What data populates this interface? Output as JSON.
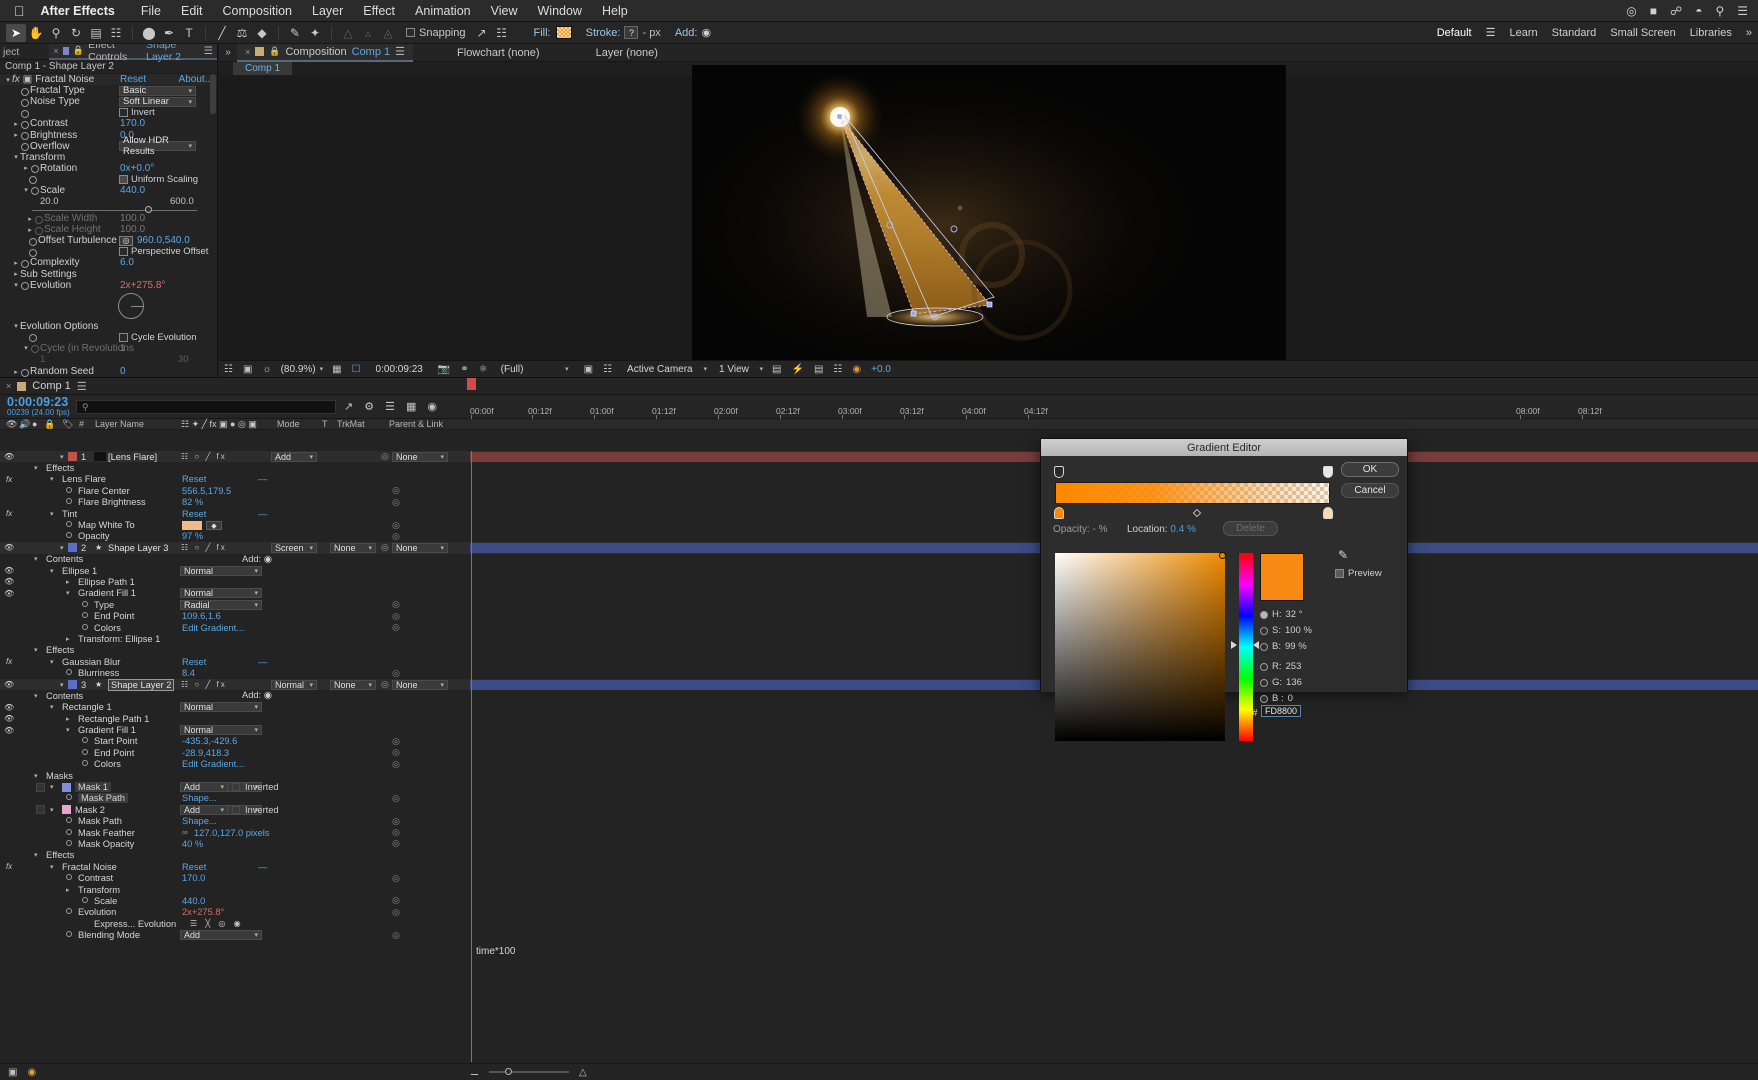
{
  "menubar": {
    "apple": "apple-logo",
    "app": "After Effects",
    "items": [
      "File",
      "Edit",
      "Composition",
      "Layer",
      "Effect",
      "Animation",
      "View",
      "Window",
      "Help"
    ],
    "status_icons": [
      "screen-record-icon",
      "battery-icon",
      "bluetooth-icon",
      "wifi-icon",
      "search-icon",
      "control-center-icon"
    ]
  },
  "toolbar": {
    "tools": [
      "selection-tool",
      "hand-tool",
      "zoom-tool",
      "rotation-tool",
      "camera-tool",
      "pan-behind-tool",
      "shape-tool",
      "pen-tool",
      "type-tool",
      "brush-tool",
      "clone-stamp-tool",
      "eraser-tool",
      "roto-brush-tool",
      "puppet-pin-tool"
    ],
    "dim_tools": [
      "puppet-starch-tool",
      "puppet-overlap-tool",
      "puppet-advanced-tool"
    ],
    "snapping_label": "Snapping",
    "snapping_checked": false,
    "fill_label": "Fill:",
    "stroke_label": "Stroke:",
    "stroke_value": "?",
    "stroke_unit": "- px",
    "add_label": "Add:",
    "fill_color": "#f49c2e",
    "workspaces": [
      "Default",
      "Learn",
      "Standard",
      "Small Screen",
      "Libraries"
    ],
    "workspace_active": "Default"
  },
  "effect_controls": {
    "project_tab": "ject",
    "tab_prefix": "Effect Controls",
    "tab_layer": "Shape Layer 2",
    "subtitle": "Comp 1 - Shape Layer 2",
    "effect_name": "Fractal Noise",
    "reset": "Reset",
    "about": "About...",
    "rows": [
      {
        "label": "Fractal Type",
        "value": "Basic",
        "kind": "select"
      },
      {
        "label": "Noise Type",
        "value": "Soft Linear",
        "kind": "select"
      },
      {
        "label": "Invert",
        "value": "",
        "kind": "checkbox",
        "checked": false
      },
      {
        "label": "Contrast",
        "value": "170.0",
        "kind": "num"
      },
      {
        "label": "Brightness",
        "value": "0.0",
        "kind": "num"
      },
      {
        "label": "Overflow",
        "value": "Allow HDR Results",
        "kind": "select"
      },
      {
        "label": "Transform",
        "value": "",
        "kind": "group"
      },
      {
        "label": "Rotation",
        "value": "0x+0.0°",
        "kind": "num"
      },
      {
        "label": "Uniform Scaling",
        "value": "",
        "kind": "checkbox",
        "checked": true
      },
      {
        "label": "Scale",
        "value": "440.0",
        "kind": "num"
      },
      {
        "label": "Scale Width",
        "value": "100.0",
        "kind": "num-dim"
      },
      {
        "label": "Scale Height",
        "value": "100.0",
        "kind": "num-dim"
      },
      {
        "label": "Offset Turbulence",
        "value": "960.0,540.0",
        "kind": "point"
      },
      {
        "label": "Perspective Offset",
        "value": "",
        "kind": "checkbox",
        "checked": false
      },
      {
        "label": "Complexity",
        "value": "6.0",
        "kind": "num"
      },
      {
        "label": "Sub Settings",
        "value": "",
        "kind": "group"
      },
      {
        "label": "Evolution",
        "value": "2x+275.8°",
        "kind": "angle"
      },
      {
        "label": "Evolution Options",
        "value": "",
        "kind": "group"
      },
      {
        "label": "Cycle Evolution",
        "value": "",
        "kind": "checkbox",
        "checked": false
      },
      {
        "label": "Cycle (in Revolutions",
        "value": "1",
        "kind": "num-dim"
      },
      {
        "label": "Random Seed",
        "value": "0",
        "kind": "num"
      }
    ],
    "slider": {
      "min": "20.0",
      "max": "600.0"
    },
    "cycle_max": "30"
  },
  "comp_panel": {
    "expand": "»",
    "tab_prefix": "Composition",
    "tab_name": "Comp 1",
    "flowchart": "Flowchart (none)",
    "layer": "Layer (none)",
    "comp_tag": "Comp 1",
    "viewer_toolbar": {
      "magnification": "(80.9%)",
      "timecode": "0:00:09:23",
      "resolution": "(Full)",
      "camera": "Active Camera",
      "views": "1 View",
      "exposure": "+0.0"
    }
  },
  "timeline": {
    "tab_name": "Comp 1",
    "current_time": "0:00:09:23",
    "frame_info": "00239 (24.00 fps)",
    "search_placeholder": "",
    "ruler_ticks": [
      "00:00f",
      "00:12f",
      "01:00f",
      "01:12f",
      "02:00f",
      "02:12f",
      "03:00f",
      "03:12f",
      "04:00f",
      "04:12f",
      "08:00f",
      "08:12f"
    ],
    "columns": [
      "#",
      "Layer Name",
      "Mode",
      "T",
      "TrkMat",
      "Parent & Link"
    ],
    "expression": "time*100",
    "rows": [
      {
        "indent": 0,
        "type": "layer",
        "num": "1",
        "name": "[Lens Flare]",
        "mode": "Add",
        "trkmat": "",
        "parent": "None",
        "color": "#c0544a",
        "label_sw": true
      },
      {
        "indent": 1,
        "type": "group",
        "name": "Effects"
      },
      {
        "indent": 2,
        "type": "effect",
        "name": "Lens Flare",
        "value": "Reset",
        "dash": true
      },
      {
        "indent": 3,
        "type": "prop",
        "name": "Flare Center",
        "value": "556.5,179.5"
      },
      {
        "indent": 3,
        "type": "prop",
        "name": "Flare Brightness",
        "value": "82 %"
      },
      {
        "indent": 2,
        "type": "effect",
        "name": "Tint",
        "value": "Reset",
        "dash": true
      },
      {
        "indent": 3,
        "type": "prop",
        "name": "Map White To",
        "value": "",
        "swatch": "#f0bb8a"
      },
      {
        "indent": 3,
        "type": "prop",
        "name": "Opacity",
        "value": "97 %"
      },
      {
        "indent": 0,
        "type": "layer",
        "num": "2",
        "name": "Shape Layer 3",
        "mode": "Screen",
        "trkmat": "None",
        "parent": "None",
        "color": "#5b6fc9",
        "add": "Add:"
      },
      {
        "indent": 1,
        "type": "group",
        "name": "Contents",
        "add": "Add:"
      },
      {
        "indent": 2,
        "type": "shape",
        "name": "Ellipse 1",
        "mode": "Normal"
      },
      {
        "indent": 3,
        "type": "path",
        "name": "Ellipse Path 1"
      },
      {
        "indent": 3,
        "type": "shape",
        "name": "Gradient Fill 1",
        "mode": "Normal"
      },
      {
        "indent": 4,
        "type": "prop-plain",
        "name": "Type",
        "mode": "Radial"
      },
      {
        "indent": 4,
        "type": "prop",
        "name": "End Point",
        "value": "109.6,1.6"
      },
      {
        "indent": 4,
        "type": "prop",
        "name": "Colors",
        "value": "Edit Gradient..."
      },
      {
        "indent": 3,
        "type": "group-c",
        "name": "Transform: Ellipse 1"
      },
      {
        "indent": 1,
        "type": "group",
        "name": "Effects"
      },
      {
        "indent": 2,
        "type": "effect",
        "name": "Gaussian Blur",
        "value": "Reset",
        "dash": true
      },
      {
        "indent": 3,
        "type": "prop",
        "name": "Blurriness",
        "value": "8.4"
      },
      {
        "indent": 0,
        "type": "layer",
        "num": "3",
        "name": "Shape Layer 2",
        "mode": "Normal",
        "trkmat": "None",
        "parent": "None",
        "color": "#5b6fc9",
        "selected": true
      },
      {
        "indent": 1,
        "type": "group",
        "name": "Contents",
        "add": "Add:"
      },
      {
        "indent": 2,
        "type": "shape",
        "name": "Rectangle 1",
        "mode": "Normal"
      },
      {
        "indent": 3,
        "type": "path",
        "name": "Rectangle Path 1"
      },
      {
        "indent": 3,
        "type": "shape",
        "name": "Gradient Fill 1",
        "mode": "Normal"
      },
      {
        "indent": 4,
        "type": "prop",
        "name": "Start Point",
        "value": "-435.3,-429.6"
      },
      {
        "indent": 4,
        "type": "prop",
        "name": "End Point",
        "value": "-28.9,418.3"
      },
      {
        "indent": 4,
        "type": "prop",
        "name": "Colors",
        "value": "Edit Gradient..."
      },
      {
        "indent": 1,
        "type": "group",
        "name": "Masks"
      },
      {
        "indent": 2,
        "type": "mask",
        "name": "Mask 1",
        "mode": "Add",
        "inverted": "Inverted",
        "color": "#7f8fd8",
        "highlight": true
      },
      {
        "indent": 3,
        "type": "prop",
        "name": "Mask Path",
        "value": "Shape...",
        "highlight": true
      },
      {
        "indent": 2,
        "type": "mask",
        "name": "Mask 2",
        "mode": "Add",
        "inverted": "Inverted",
        "color": "#e8a6cf"
      },
      {
        "indent": 3,
        "type": "prop",
        "name": "Mask Path",
        "value": "Shape..."
      },
      {
        "indent": 3,
        "type": "prop",
        "name": "Mask Feather",
        "value": "127.0,127.0 pixels",
        "link": true
      },
      {
        "indent": 3,
        "type": "prop",
        "name": "Mask Opacity",
        "value": "40 %"
      },
      {
        "indent": 1,
        "type": "group",
        "name": "Effects"
      },
      {
        "indent": 2,
        "type": "effect",
        "name": "Fractal Noise",
        "value": "Reset",
        "dash": true
      },
      {
        "indent": 3,
        "type": "prop",
        "name": "Contrast",
        "value": "170.0"
      },
      {
        "indent": 3,
        "type": "group-c",
        "name": "Transform"
      },
      {
        "indent": 4,
        "type": "prop",
        "name": "Scale",
        "value": "440.0"
      },
      {
        "indent": 3,
        "type": "prop-red",
        "name": "Evolution",
        "value": "2x+275.8°"
      },
      {
        "indent": 4,
        "type": "expr",
        "name": "Express... Evolution"
      },
      {
        "indent": 3,
        "type": "prop-plain",
        "name": "Blending Mode",
        "mode": "Add"
      }
    ]
  },
  "gradient_editor": {
    "title": "Gradient Editor",
    "ok": "OK",
    "cancel": "Cancel",
    "opacity_label": "Opacity:",
    "opacity_value": "- %",
    "location_label": "Location:",
    "location_value": "0.4 %",
    "delete": "Delete",
    "preview_label": "Preview",
    "preview_checked": true,
    "eyedropper": "eyedropper-icon",
    "fields": [
      {
        "key": "H:",
        "value": "32 °",
        "selected": true
      },
      {
        "key": "S:",
        "value": "100 %",
        "selected": false
      },
      {
        "key": "B:",
        "value": "99 %",
        "selected": false
      },
      {
        "key": "R:",
        "value": "253",
        "selected": false
      },
      {
        "key": "G:",
        "value": "136",
        "selected": false
      },
      {
        "key": "B :",
        "value": "0",
        "selected": false
      }
    ],
    "hex": "FD8800",
    "swatch_color": "#FD8800"
  }
}
